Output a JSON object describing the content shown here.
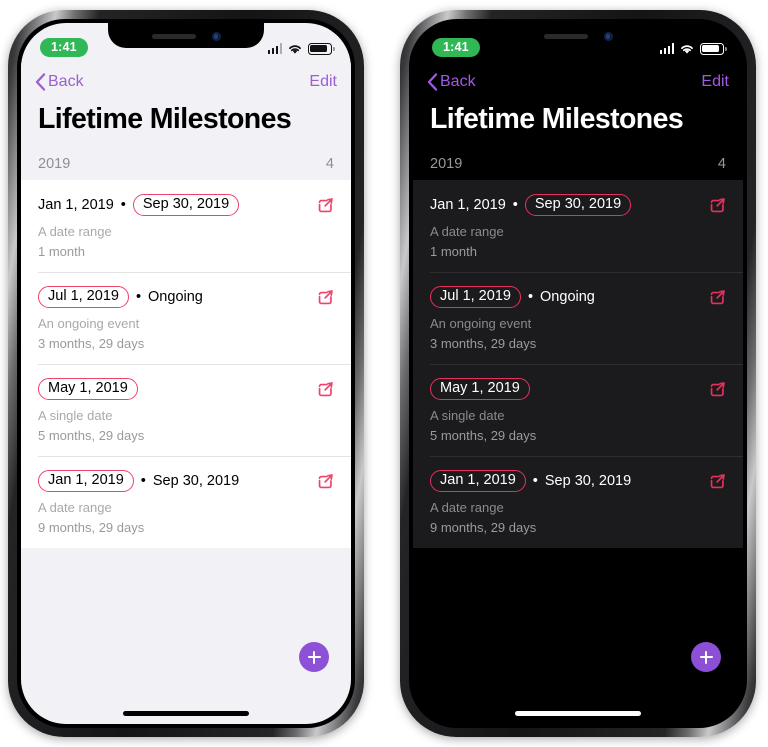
{
  "status_bar": {
    "time": "1:41",
    "signal_icon": "cellular-bars-icon",
    "wifi_icon": "wifi-icon",
    "battery_icon": "battery-icon"
  },
  "nav": {
    "back_label": "Back",
    "back_icon": "chevron-left-icon",
    "edit_label": "Edit"
  },
  "page_title": "Lifetime Milestones",
  "section": {
    "title": "2019",
    "count": "4"
  },
  "rows": [
    {
      "start_date": "Jan 1, 2019",
      "separator": "•",
      "end_date": "Sep 30, 2019",
      "highlight": "end",
      "description": "A date range",
      "duration": "1 month",
      "edit_icon": "edit-square-pencil-icon"
    },
    {
      "start_date": "Jul 1, 2019",
      "separator": "•",
      "end_date": "Ongoing",
      "highlight": "start",
      "description": "An ongoing event",
      "duration": "3 months, 29 days",
      "edit_icon": "edit-square-pencil-icon"
    },
    {
      "start_date": "May 1, 2019",
      "separator": "",
      "end_date": "",
      "highlight": "start",
      "description": "A single date",
      "duration": "5 months, 29 days",
      "edit_icon": "edit-square-pencil-icon"
    },
    {
      "start_date": "Jan 1, 2019",
      "separator": "•",
      "end_date": "Sep 30, 2019",
      "highlight": "start",
      "description": "A date range",
      "duration": "9 months, 29 days",
      "edit_icon": "edit-square-pencil-icon"
    }
  ],
  "fab": {
    "icon": "plus-icon",
    "label": "Add milestone"
  },
  "colors": {
    "accent_purple": "#9b5fd0",
    "pill_red": "#f0436a",
    "fab_purple": "#8d51d8",
    "recording_green": "#30b756",
    "light_bg": "#f2f1f6",
    "light_card": "#ffffff",
    "dark_bg": "#000000",
    "dark_card": "#1b1b1d"
  },
  "variants": [
    {
      "name": "light-mode-phone"
    },
    {
      "name": "dark-mode-phone"
    }
  ]
}
